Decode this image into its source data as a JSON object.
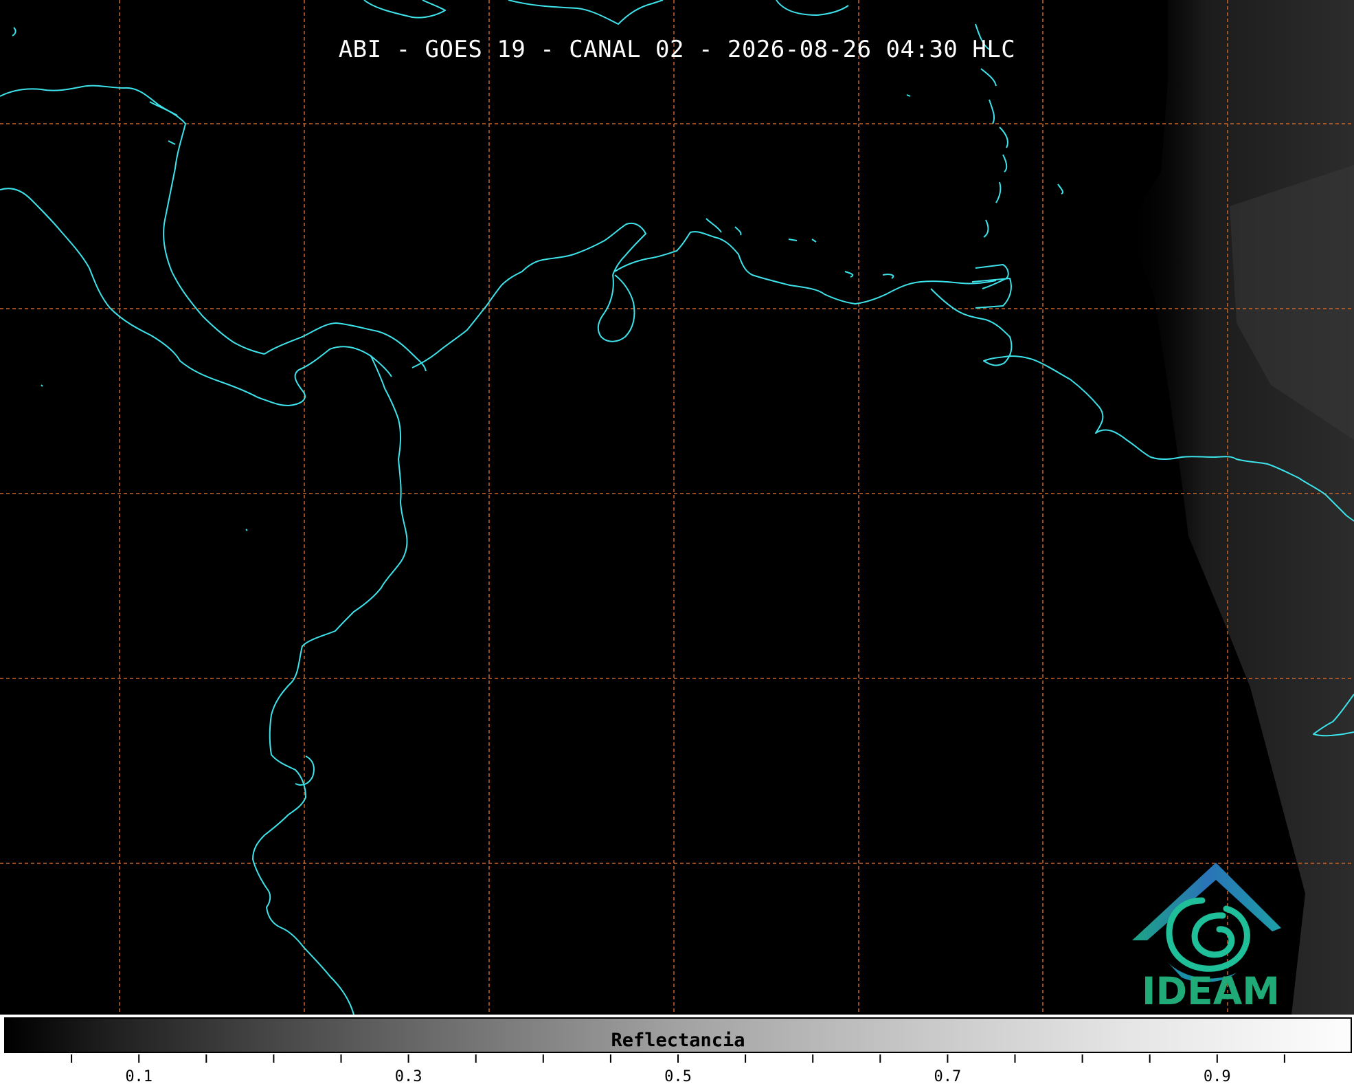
{
  "title": "ABI - GOES 19 - CANAL 02 - 2026-08-26 04:30 HLC",
  "colors": {
    "background": "#000000",
    "coastline": "#3de3ea",
    "gridline": "#c8662a",
    "logo_text": "#1faa78"
  },
  "grid": {
    "style": "dashed"
  },
  "logo": {
    "text": "IDEAM",
    "icon": "ideam-logo-icon"
  },
  "colorbar": {
    "label": "Reflectancia",
    "range": [
      0.0,
      1.0
    ],
    "tick_labels": [
      "0.1",
      "0.3",
      "0.5",
      "0.7",
      "0.9"
    ],
    "tick_values": [
      0.1,
      0.3,
      0.5,
      0.7,
      0.9
    ]
  }
}
